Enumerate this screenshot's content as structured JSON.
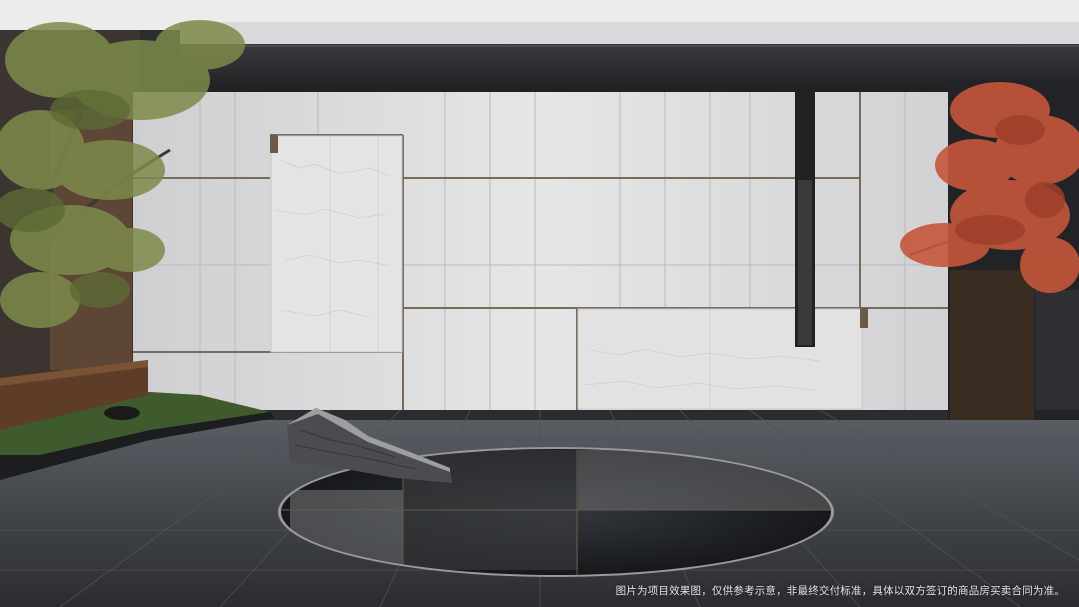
{
  "disclaimer": "图片为项目效果图，仅供参考示意，非最终交付标准，具体以双方签订的商品房买卖合同为准。",
  "colors": {
    "sky": "#e9e9ea",
    "canopy": "#2b2b2d",
    "wall": "#dcdcdc",
    "wall_trim": "#6b5a48",
    "paving": "#3d4046",
    "water": "#1e2024",
    "lawn": "#3f5a2c",
    "maple": "#c4563a",
    "tree_left": "#7d8a4a",
    "wood": "#5e3d28"
  },
  "icons": {
    "rock": "stone-sculpture-icon",
    "pool": "reflecting-pool",
    "bench": "timber-bench",
    "maple": "maple-tree",
    "left_tree": "deciduous-tree"
  }
}
